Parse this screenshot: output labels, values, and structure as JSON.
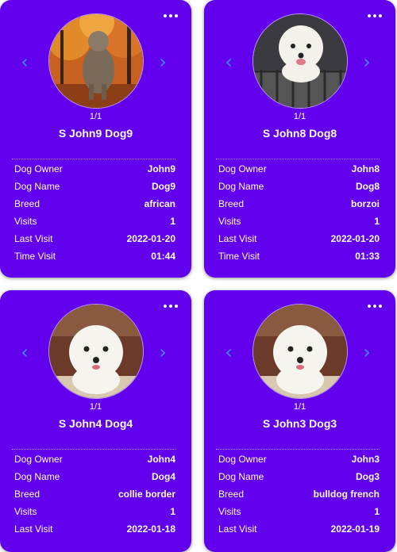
{
  "icons": {
    "menu": "more-horizontal-icon",
    "prev": "chevron-left-icon",
    "next": "chevron-right-icon"
  },
  "colors": {
    "card": "#6200ee",
    "accent": "#3b8bff",
    "text": "#ffffff"
  },
  "cards": [
    {
      "counter": "1/1",
      "title": "S John9 Dog9",
      "prev_symbol": "‹",
      "next_symbol": "›",
      "rows": [
        {
          "label": "Dog Owner",
          "value": "John9"
        },
        {
          "label": "Dog Name",
          "value": "Dog9"
        },
        {
          "label": "Breed",
          "value": "african"
        },
        {
          "label": "Visits",
          "value": "1"
        },
        {
          "label": "Last Visit",
          "value": "2022-01-20"
        },
        {
          "label": "Time Visit",
          "value": "01:44"
        }
      ]
    },
    {
      "counter": "1/1",
      "title": "S John8 Dog8",
      "prev_symbol": "‹",
      "next_symbol": "›",
      "rows": [
        {
          "label": "Dog Owner",
          "value": "John8"
        },
        {
          "label": "Dog Name",
          "value": "Dog8"
        },
        {
          "label": "Breed",
          "value": "borzoi"
        },
        {
          "label": "Visits",
          "value": "1"
        },
        {
          "label": "Last Visit",
          "value": "2022-01-20"
        },
        {
          "label": "Time Visit",
          "value": "01:33"
        }
      ]
    },
    {
      "counter": "1/1",
      "title": "S John4 Dog4",
      "prev_symbol": "‹",
      "next_symbol": "›",
      "rows": [
        {
          "label": "Dog Owner",
          "value": "John4"
        },
        {
          "label": "Dog Name",
          "value": "Dog4"
        },
        {
          "label": "Breed",
          "value": "collie border"
        },
        {
          "label": "Visits",
          "value": "1"
        },
        {
          "label": "Last Visit",
          "value": "2022-01-18"
        }
      ]
    },
    {
      "counter": "1/1",
      "title": "S John3 Dog3",
      "prev_symbol": "‹",
      "next_symbol": "›",
      "rows": [
        {
          "label": "Dog Owner",
          "value": "John3"
        },
        {
          "label": "Dog Name",
          "value": "Dog3"
        },
        {
          "label": "Breed",
          "value": "bulldog french"
        },
        {
          "label": "Visits",
          "value": "1"
        },
        {
          "label": "Last Visit",
          "value": "2022-01-19"
        }
      ]
    }
  ]
}
